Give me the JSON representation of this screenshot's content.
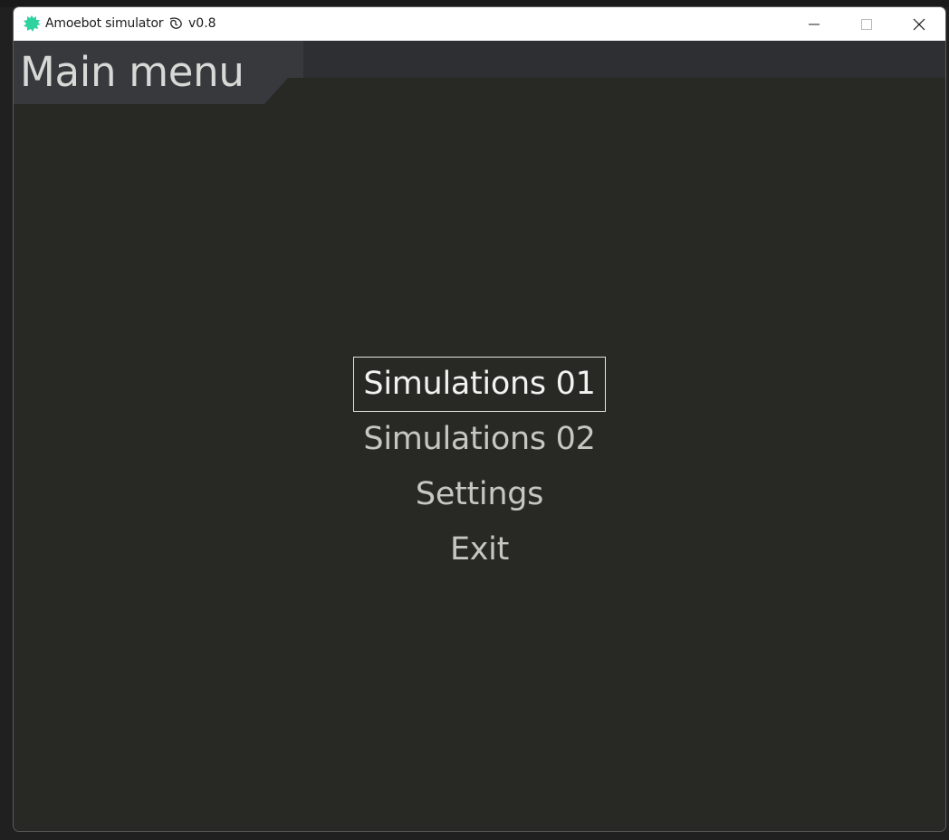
{
  "window": {
    "title": "Amoebot simulator",
    "version": "v0.8",
    "icon": "amoeba-icon",
    "title_emoji": "clock-leaf-icon",
    "controls": {
      "minimize": "minimize-icon",
      "maximize": "maximize-icon",
      "close": "close-icon"
    }
  },
  "header": {
    "title": "Main menu"
  },
  "menu": {
    "items": [
      {
        "label": "Simulations 01",
        "selected": true
      },
      {
        "label": "Simulations 02",
        "selected": false
      },
      {
        "label": "Settings",
        "selected": false
      },
      {
        "label": "Exit",
        "selected": false
      }
    ]
  },
  "colors": {
    "background": "#282825",
    "header_strip": "#2e2f33",
    "header_tab": "#38393d",
    "text": "#c6c6c2",
    "selected_text": "#f2f2f0",
    "icon_accent": "#2ed3a0"
  }
}
